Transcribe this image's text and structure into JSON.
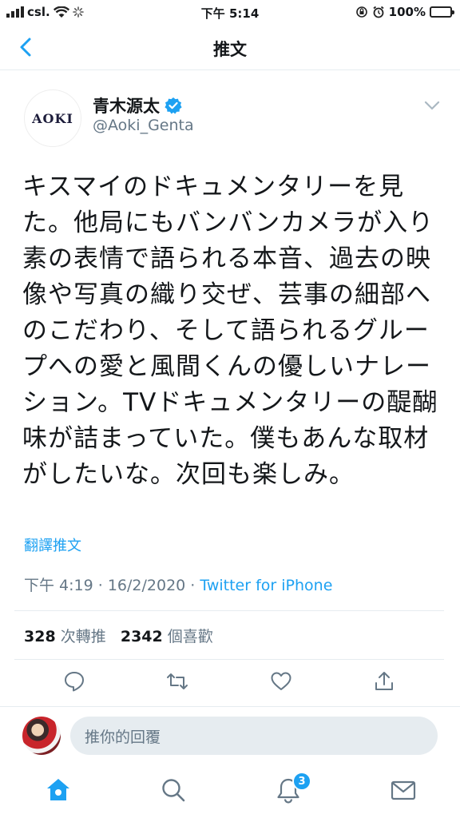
{
  "status_bar": {
    "carrier": "csl.",
    "time": "下午 5:14",
    "battery": "100%"
  },
  "nav": {
    "title": "推文"
  },
  "author": {
    "avatar_text": "AOKI",
    "name": "青木源太",
    "handle": "@Aoki_Genta"
  },
  "tweet": {
    "text": "キスマイのドキュメンタリーを見た。他局にもバンバンカメラが入り素の表情で語られる本音、過去の映像や写真の織り交ぜ、芸事の細部へのこだわり、そして語られるグループへの愛と風間くんの優しいナレーション。TVドキュメンタリーの醍醐味が詰まっていた。僕もあんな取材がしたいな。次回も楽しみ。",
    "translate_label": "翻譯推文",
    "timestamp": "下午 4:19 · 16/2/2020 · ",
    "source": "Twitter for iPhone"
  },
  "stats": {
    "retweets": "328",
    "retweets_label": " 次轉推",
    "likes": "2342",
    "likes_label": " 個喜歡"
  },
  "reply": {
    "placeholder": "推你的回覆"
  },
  "tab_bar": {
    "notifications_badge": "3"
  },
  "colors": {
    "accent": "#1da1f2",
    "secondary_text": "#657786",
    "divider": "#e6ecf0"
  }
}
